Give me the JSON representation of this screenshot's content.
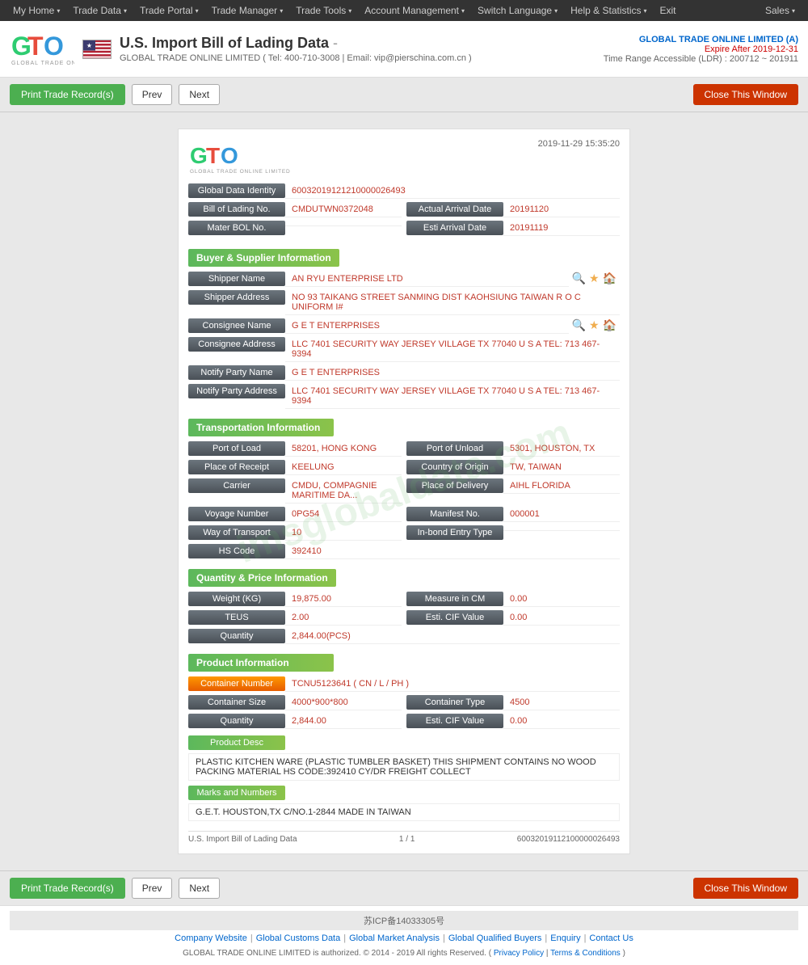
{
  "nav": {
    "items": [
      {
        "label": "My Home",
        "hasArrow": true
      },
      {
        "label": "Trade Data",
        "hasArrow": true
      },
      {
        "label": "Trade Portal",
        "hasArrow": true
      },
      {
        "label": "Trade Manager",
        "hasArrow": true
      },
      {
        "label": "Trade Tools",
        "hasArrow": true
      },
      {
        "label": "Account Management",
        "hasArrow": true
      },
      {
        "label": "Switch Language",
        "hasArrow": true
      },
      {
        "label": "Help & Statistics",
        "hasArrow": true
      },
      {
        "label": "Exit",
        "hasArrow": false
      }
    ],
    "sales_label": "Sales"
  },
  "header": {
    "title": "U.S. Import Bill of Lading Data",
    "title_suffix": "-",
    "company_info": "GLOBAL TRADE ONLINE LIMITED ( Tel: 400-710-3008 | Email: vip@pierschina.com.cn )",
    "account_name": "GLOBAL TRADE ONLINE LIMITED (A)",
    "expire_label": "Expire After 2019-12-31",
    "ldr_label": "Time Range Accessible (LDR) : 200712 ~ 201911"
  },
  "toolbar": {
    "print_label": "Print Trade Record(s)",
    "prev_label": "Prev",
    "next_label": "Next",
    "close_label": "Close This Window"
  },
  "content": {
    "timestamp": "2019-11-29 15:35:20",
    "watermark": "imsglobaldata.com",
    "global_data_identity": {
      "label": "Global Data Identity",
      "value": "60032019121210000026493"
    },
    "bill_of_lading": {
      "label": "Bill of Lading No.",
      "value": "CMDUTWN0372048",
      "actual_arrival_label": "Actual Arrival Date",
      "actual_arrival_value": "20191120"
    },
    "master_bol": {
      "label": "Mater BOL No.",
      "esti_arrival_label": "Esti Arrival Date",
      "esti_arrival_value": "20191119"
    },
    "buyer_supplier": {
      "section_title": "Buyer & Supplier Information",
      "shipper_name_label": "Shipper Name",
      "shipper_name_value": "AN RYU ENTERPRISE LTD",
      "shipper_address_label": "Shipper Address",
      "shipper_address_value": "NO 93 TAIKANG STREET SANMING DIST KAOHSIUNG TAIWAN R O C UNIFORM I#",
      "consignee_name_label": "Consignee Name",
      "consignee_name_value": "G E T ENTERPRISES",
      "consignee_address_label": "Consignee Address",
      "consignee_address_value": "LLC 7401 SECURITY WAY JERSEY VILLAGE TX 77040 U S A TEL: 713 467-9394",
      "notify_party_name_label": "Notify Party Name",
      "notify_party_name_value": "G E T ENTERPRISES",
      "notify_party_address_label": "Notify Party Address",
      "notify_party_address_value": "LLC 7401 SECURITY WAY JERSEY VILLAGE TX 77040 U S A TEL: 713 467-9394"
    },
    "transportation": {
      "section_title": "Transportation Information",
      "port_of_load_label": "Port of Load",
      "port_of_load_value": "58201, HONG KONG",
      "port_of_unload_label": "Port of Unload",
      "port_of_unload_value": "5301, HOUSTON, TX",
      "place_of_receipt_label": "Place of Receipt",
      "place_of_receipt_value": "KEELUNG",
      "country_of_origin_label": "Country of Origin",
      "country_of_origin_value": "TW, TAIWAN",
      "carrier_label": "Carrier",
      "carrier_value": "CMDU, COMPAGNIE MARITIME DA...",
      "place_of_delivery_label": "Place of Delivery",
      "place_of_delivery_value": "AIHL FLORIDA",
      "voyage_number_label": "Voyage Number",
      "voyage_number_value": "0PG54",
      "manifest_no_label": "Manifest No.",
      "manifest_no_value": "000001",
      "way_of_transport_label": "Way of Transport",
      "way_of_transport_value": "10",
      "inbond_entry_label": "In-bond Entry Type",
      "inbond_entry_value": "",
      "hs_code_label": "HS Code",
      "hs_code_value": "392410"
    },
    "quantity_price": {
      "section_title": "Quantity & Price Information",
      "weight_label": "Weight (KG)",
      "weight_value": "19,875.00",
      "measure_label": "Measure in CM",
      "measure_value": "0.00",
      "teus_label": "TEUS",
      "teus_value": "2.00",
      "esti_cif_label": "Esti. CIF Value",
      "esti_cif_value": "0.00",
      "quantity_label": "Quantity",
      "quantity_value": "2,844.00(PCS)"
    },
    "product_info": {
      "section_title": "Product Information",
      "container_number_label": "Container Number",
      "container_number_value": "TCNU5123641 ( CN / L / PH )",
      "container_size_label": "Container Size",
      "container_size_value": "4000*900*800",
      "container_type_label": "Container Type",
      "container_type_value": "4500",
      "quantity_label": "Quantity",
      "quantity_value": "2,844.00",
      "esti_cif_label": "Esti. CIF Value",
      "esti_cif_value": "0.00",
      "product_desc_label": "Product Desc",
      "product_desc_value": "PLASTIC KITCHEN WARE (PLASTIC TUMBLER BASKET) THIS SHIPMENT CONTAINS NO WOOD PACKING MATERIAL HS CODE:392410 CY/DR FREIGHT COLLECT",
      "marks_numbers_label": "Marks and Numbers",
      "marks_numbers_value": "G.E.T. HOUSTON,TX C/NO.1-2844 MADE IN TAIWAN"
    },
    "footer": {
      "left": "U.S. Import Bill of Lading Data",
      "center": "1 / 1",
      "right": "60032019112100000026493"
    }
  },
  "bottom_toolbar": {
    "print_label": "Print Trade Record(s)",
    "prev_label": "Prev",
    "next_label": "Next",
    "close_label": "Close This Window"
  },
  "page_footer": {
    "icp": "苏ICP备14033305号",
    "links": [
      {
        "label": "Company Website"
      },
      {
        "label": "Global Customs Data"
      },
      {
        "label": "Global Market Analysis"
      },
      {
        "label": "Global Qualified Buyers"
      },
      {
        "label": "Enquiry"
      },
      {
        "label": "Contact Us"
      }
    ],
    "copyright": "GLOBAL TRADE ONLINE LIMITED is authorized. © 2014 - 2019 All rights Reserved. (",
    "privacy_policy": "Privacy Policy",
    "terms": "Terms & Conditions",
    "copyright_end": ")"
  }
}
